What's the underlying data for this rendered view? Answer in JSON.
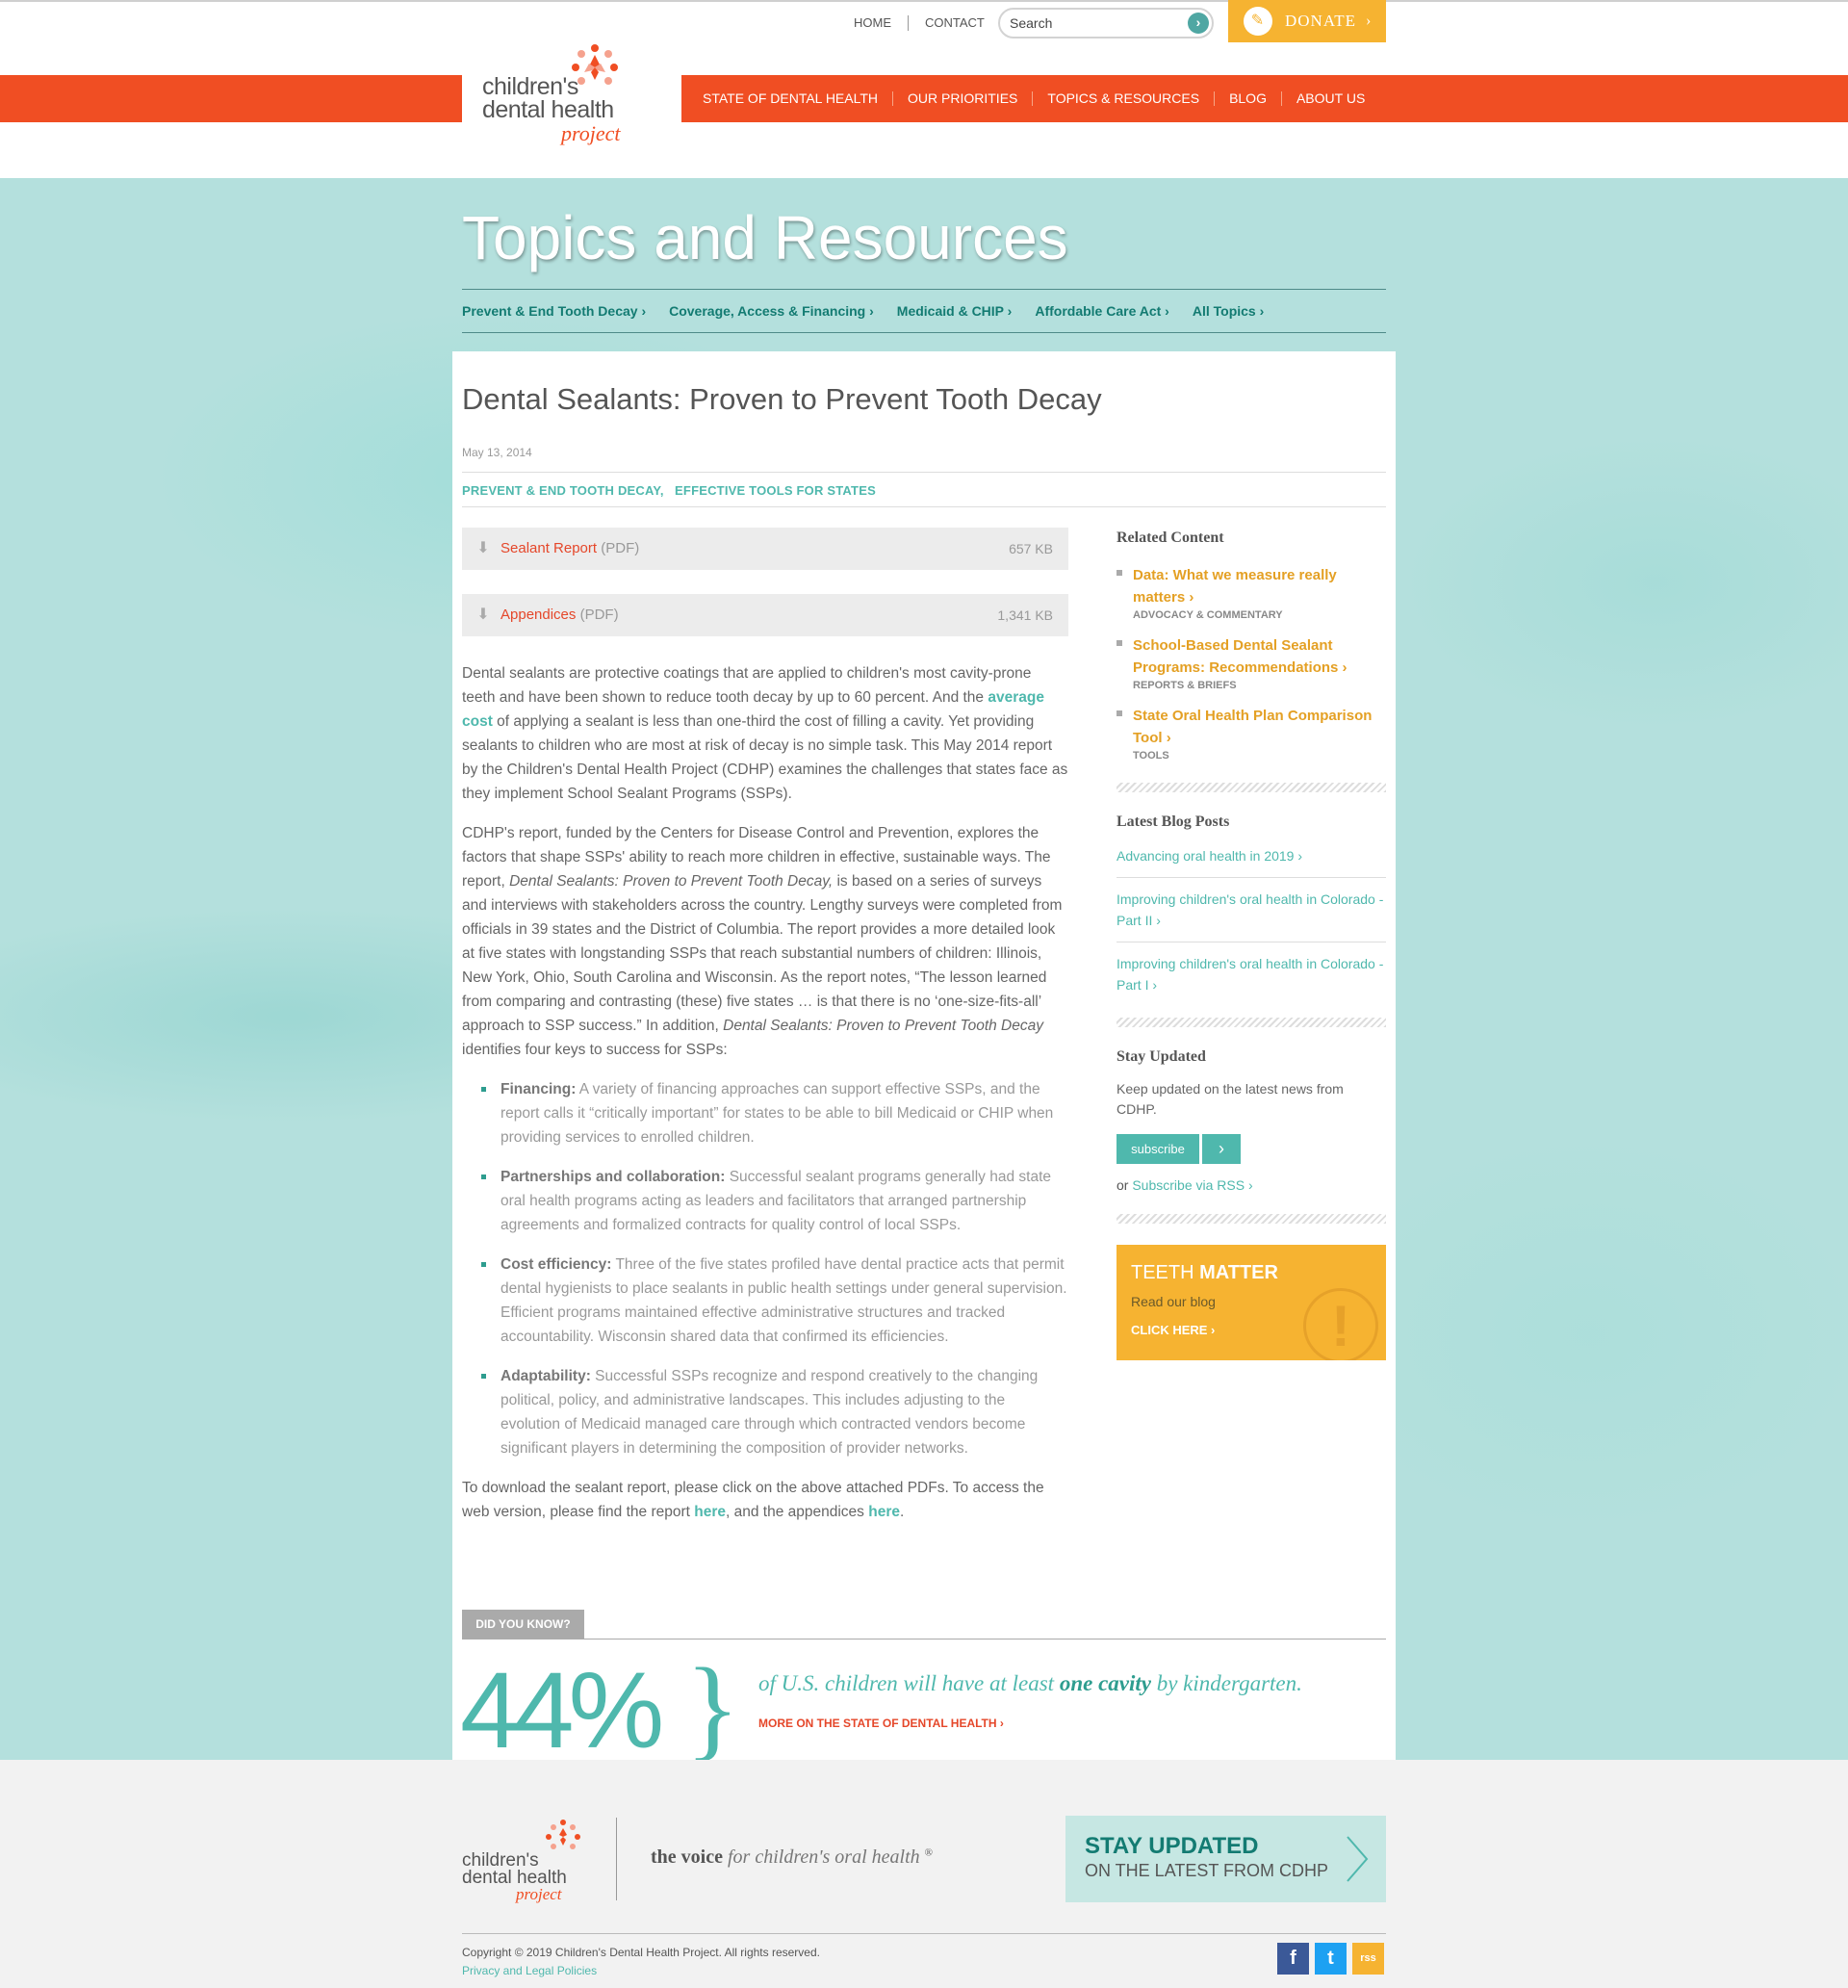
{
  "header": {
    "utility": {
      "home": "HOME",
      "contact": "CONTACT"
    },
    "search": {
      "placeholder": "Search",
      "value": ""
    },
    "donate_label": "DONATE",
    "logo": {
      "line1": "children's",
      "line2": "dental health",
      "line3": "project"
    },
    "main_nav": [
      "STATE OF DENTAL HEALTH",
      "OUR PRIORITIES",
      "TOPICS & RESOURCES",
      "BLOG",
      "ABOUT US"
    ]
  },
  "hero": {
    "title": "Topics and Resources",
    "topics_nav": [
      "Prevent & End Tooth Decay ›",
      "Coverage, Access & Financing ›",
      "Medicaid & CHIP ›",
      "Affordable Care Act ›",
      "All Topics ›"
    ]
  },
  "article": {
    "title": "Dental Sealants: Proven to Prevent Tooth Decay",
    "date": "May 13, 2014",
    "tags": "PREVENT & END TOOTH DECAY,   EFFECTIVE TOOLS FOR STATES",
    "downloads": [
      {
        "name": "Sealant Report",
        "type": "(PDF)",
        "size": "657 KB"
      },
      {
        "name": "Appendices",
        "type": "(PDF)",
        "size": "1,341 KB"
      }
    ],
    "p1_a": "Dental sealants are protective coatings that are applied to children's most cavity-prone teeth and have been shown to reduce tooth decay by up to 60 percent. And the ",
    "p1_link": "average cost",
    "p1_b": " of applying a sealant is less than one-third the cost of filling a cavity. Yet providing sealants to children who are most at risk of decay is no simple task. This May 2014 report by the Children's Dental Health Project (CDHP) examines the challenges that states face as they implement School Sealant Programs (SSPs).",
    "p2_a": "CDHP's report, funded by the Centers for Disease Control and Prevention, explores the factors that shape SSPs' ability to reach more children in effective, sustainable ways. The report, ",
    "p2_em1": "Dental Sealants: Proven to Prevent Tooth Decay,",
    "p2_b": " is based on a series of surveys and interviews with stakeholders across the country. Lengthy surveys were completed from officials in 39 states and the District of Columbia. The report provides a more detailed look at five states with longstanding SSPs that reach substantial numbers of children: Illinois, New York, Ohio, South Carolina and Wisconsin. As the report notes, “The lesson learned from comparing and contrasting (these) five states … is that there is no ‘one-size-fits-all’ approach to SSP success.” In addition, ",
    "p2_em2": "Dental Sealants: Proven to Prevent Tooth Decay",
    "p2_c": " identifies four keys to success for SSPs:",
    "keys": [
      {
        "label": "Financing:",
        "text": " A variety of financing approaches can support effective SSPs, and the report calls it “critically important” for states to be able to bill Medicaid or CHIP when providing services to enrolled children."
      },
      {
        "label": "Partnerships and collaboration:",
        "text": " Successful sealant programs generally had state oral health programs acting as leaders and facilitators that arranged partnership agreements and formalized contracts for quality control of local SSPs."
      },
      {
        "label": "Cost efficiency:",
        "text": " Three of the five states profiled have dental practice acts that permit dental hygienists to place sealants in public health settings under general supervision. Efficient programs maintained effective administrative structures and tracked accountability. Wisconsin shared data that confirmed its efficiencies."
      },
      {
        "label": "Adaptability:",
        "text": " Successful SSPs recognize and respond creatively to the changing political, policy, and administrative landscapes. This includes adjusting to the evolution of Medicaid managed care through which contracted vendors become significant players in determining the composition of provider networks."
      }
    ],
    "p3_a": "To download the sealant report, please click on the above attached PDFs. To access the web version, please find the report ",
    "p3_link1": "here",
    "p3_b": ", and the appendices ",
    "p3_link2": "here",
    "p3_c": "."
  },
  "sidebar": {
    "related_heading": "Related Content",
    "related": [
      {
        "title": "Data: What we measure really matters ›",
        "type": "ADVOCACY & COMMENTARY"
      },
      {
        "title": "School-Based Dental Sealant Programs: Recommendations ›",
        "type": "REPORTS & BRIEFS"
      },
      {
        "title": "State Oral Health Plan Comparison Tool ›",
        "type": "TOOLS"
      }
    ],
    "blog_heading": "Latest Blog Posts",
    "blog_posts": [
      "Advancing oral health in 2019 ›",
      "Improving children's oral health in Colorado - Part II ›",
      "Improving children's oral health in Colorado - Part I ›"
    ],
    "stay_heading": "Stay Updated",
    "stay_text": "Keep updated on the latest news from CDHP.",
    "subscribe_label": "subscribe",
    "rss_prefix": "or ",
    "rss_link": "Subscribe via RSS ›",
    "teeth": {
      "title_a": "TEETH ",
      "title_b": "MATTER",
      "sub": "Read our blog",
      "cta": "CLICK HERE ›"
    }
  },
  "did_you_know": {
    "tab": "DID YOU KNOW?",
    "stat": "44%",
    "brace": "}",
    "text_a": "of U.S. children will have at least ",
    "text_b": "one cavity",
    "text_c": " by kindergarten.",
    "link": "MORE ON THE STATE OF DENTAL HEALTH ›"
  },
  "footer": {
    "logo": {
      "line1": "children's",
      "line2": "dental health",
      "line3": "project"
    },
    "tagline_a": "the voice",
    "tagline_b": " for children's oral health",
    "tagline_reg": "®",
    "cta_title": "STAY UPDATED",
    "cta_sub": "ON THE LATEST FROM CDHP",
    "copyright": "Copyright © 2019 Children's Dental Health Project. All rights reserved.",
    "privacy": "Privacy and Legal Policies",
    "social": {
      "facebook": "f",
      "twitter": "t",
      "rss": "rss"
    }
  },
  "colors": {
    "brand_orange": "#f04e23",
    "accent_teal": "#4fb8ad",
    "dark_teal": "#137b72",
    "gold": "#f6b331"
  }
}
